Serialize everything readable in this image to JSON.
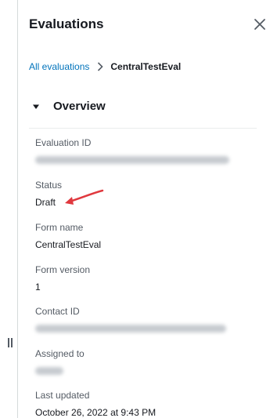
{
  "panel": {
    "title": "Evaluations",
    "close_icon": "close-icon",
    "breadcrumb": {
      "link": "All evaluations",
      "separator_icon": "chevron-right-icon",
      "current": "CentralTestEval"
    },
    "section": {
      "title": "Overview",
      "expanded": true
    },
    "fields": [
      {
        "label": "Evaluation ID",
        "value": "",
        "redacted": true
      },
      {
        "label": "Status",
        "value": "Draft",
        "redacted": false
      },
      {
        "label": "Form name",
        "value": "CentralTestEval",
        "redacted": false
      },
      {
        "label": "Form version",
        "value": "1",
        "redacted": false
      },
      {
        "label": "Contact ID",
        "value": "",
        "redacted": true
      },
      {
        "label": "Assigned to",
        "value": "",
        "redacted": true
      },
      {
        "label": "Last updated",
        "value": "October 26, 2022 at 9:43 PM",
        "redacted": false
      }
    ]
  },
  "annotation": {
    "arrow_color": "#e0383e",
    "points_to": "Status"
  },
  "colors": {
    "link": "#0073bb",
    "text": "#16191f",
    "label": "#545b64",
    "divider": "#eaeded"
  }
}
